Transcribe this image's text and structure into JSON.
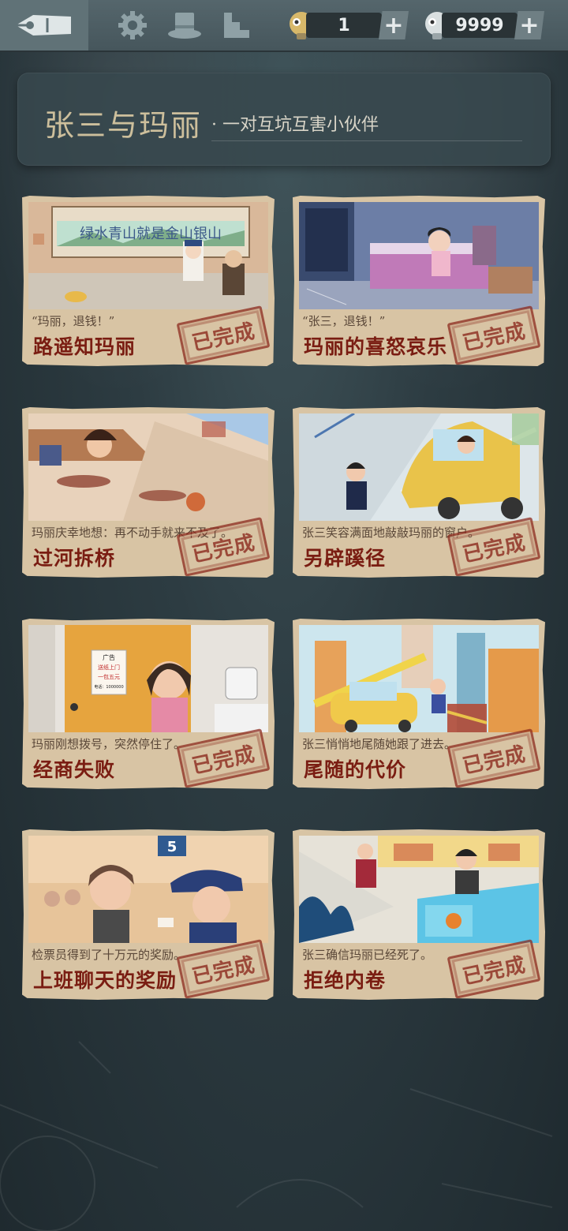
{
  "topbar": {
    "icons": [
      "pen-nib-icon",
      "gear-icon",
      "top-hat-icon",
      "stairs-icon"
    ],
    "hint_count": "1",
    "coin_count": "9999",
    "plus_label": "+"
  },
  "header": {
    "title": "张三与玛丽",
    "subtitle": "· 一对互坑互害小伙伴"
  },
  "stamp_label": "已完成",
  "cards": [
    {
      "caption": "“玛丽，退钱！”",
      "title": "路遥知玛丽",
      "banner": "绿水青山就是金山银山"
    },
    {
      "caption": "“张三，退钱！”",
      "title": "玛丽的喜怒哀乐"
    },
    {
      "caption": "玛丽庆幸地想：再不动手就来不及了。",
      "title": "过河拆桥"
    },
    {
      "caption": "张三笑容满面地敲敲玛丽的窗户。",
      "title": "另辟蹊径"
    },
    {
      "caption": "玛丽刚想拨号，突然停住了。",
      "title": "经商失败",
      "poster": [
        "广告",
        "送纸上门",
        "一包五元",
        "电话：1000000"
      ]
    },
    {
      "caption": "张三悄悄地尾随她跟了进去。",
      "title": "尾随的代价"
    },
    {
      "caption": "检票员得到了十万元的奖励。",
      "title": "上班聊天的奖励",
      "sign": "5"
    },
    {
      "caption": "张三确信玛丽已经死了。",
      "title": "拒绝内卷"
    }
  ],
  "colors": {
    "accent_red": "#7a1d12",
    "paper": "#d8c4a4",
    "title_gold": "#cdbf9c"
  }
}
